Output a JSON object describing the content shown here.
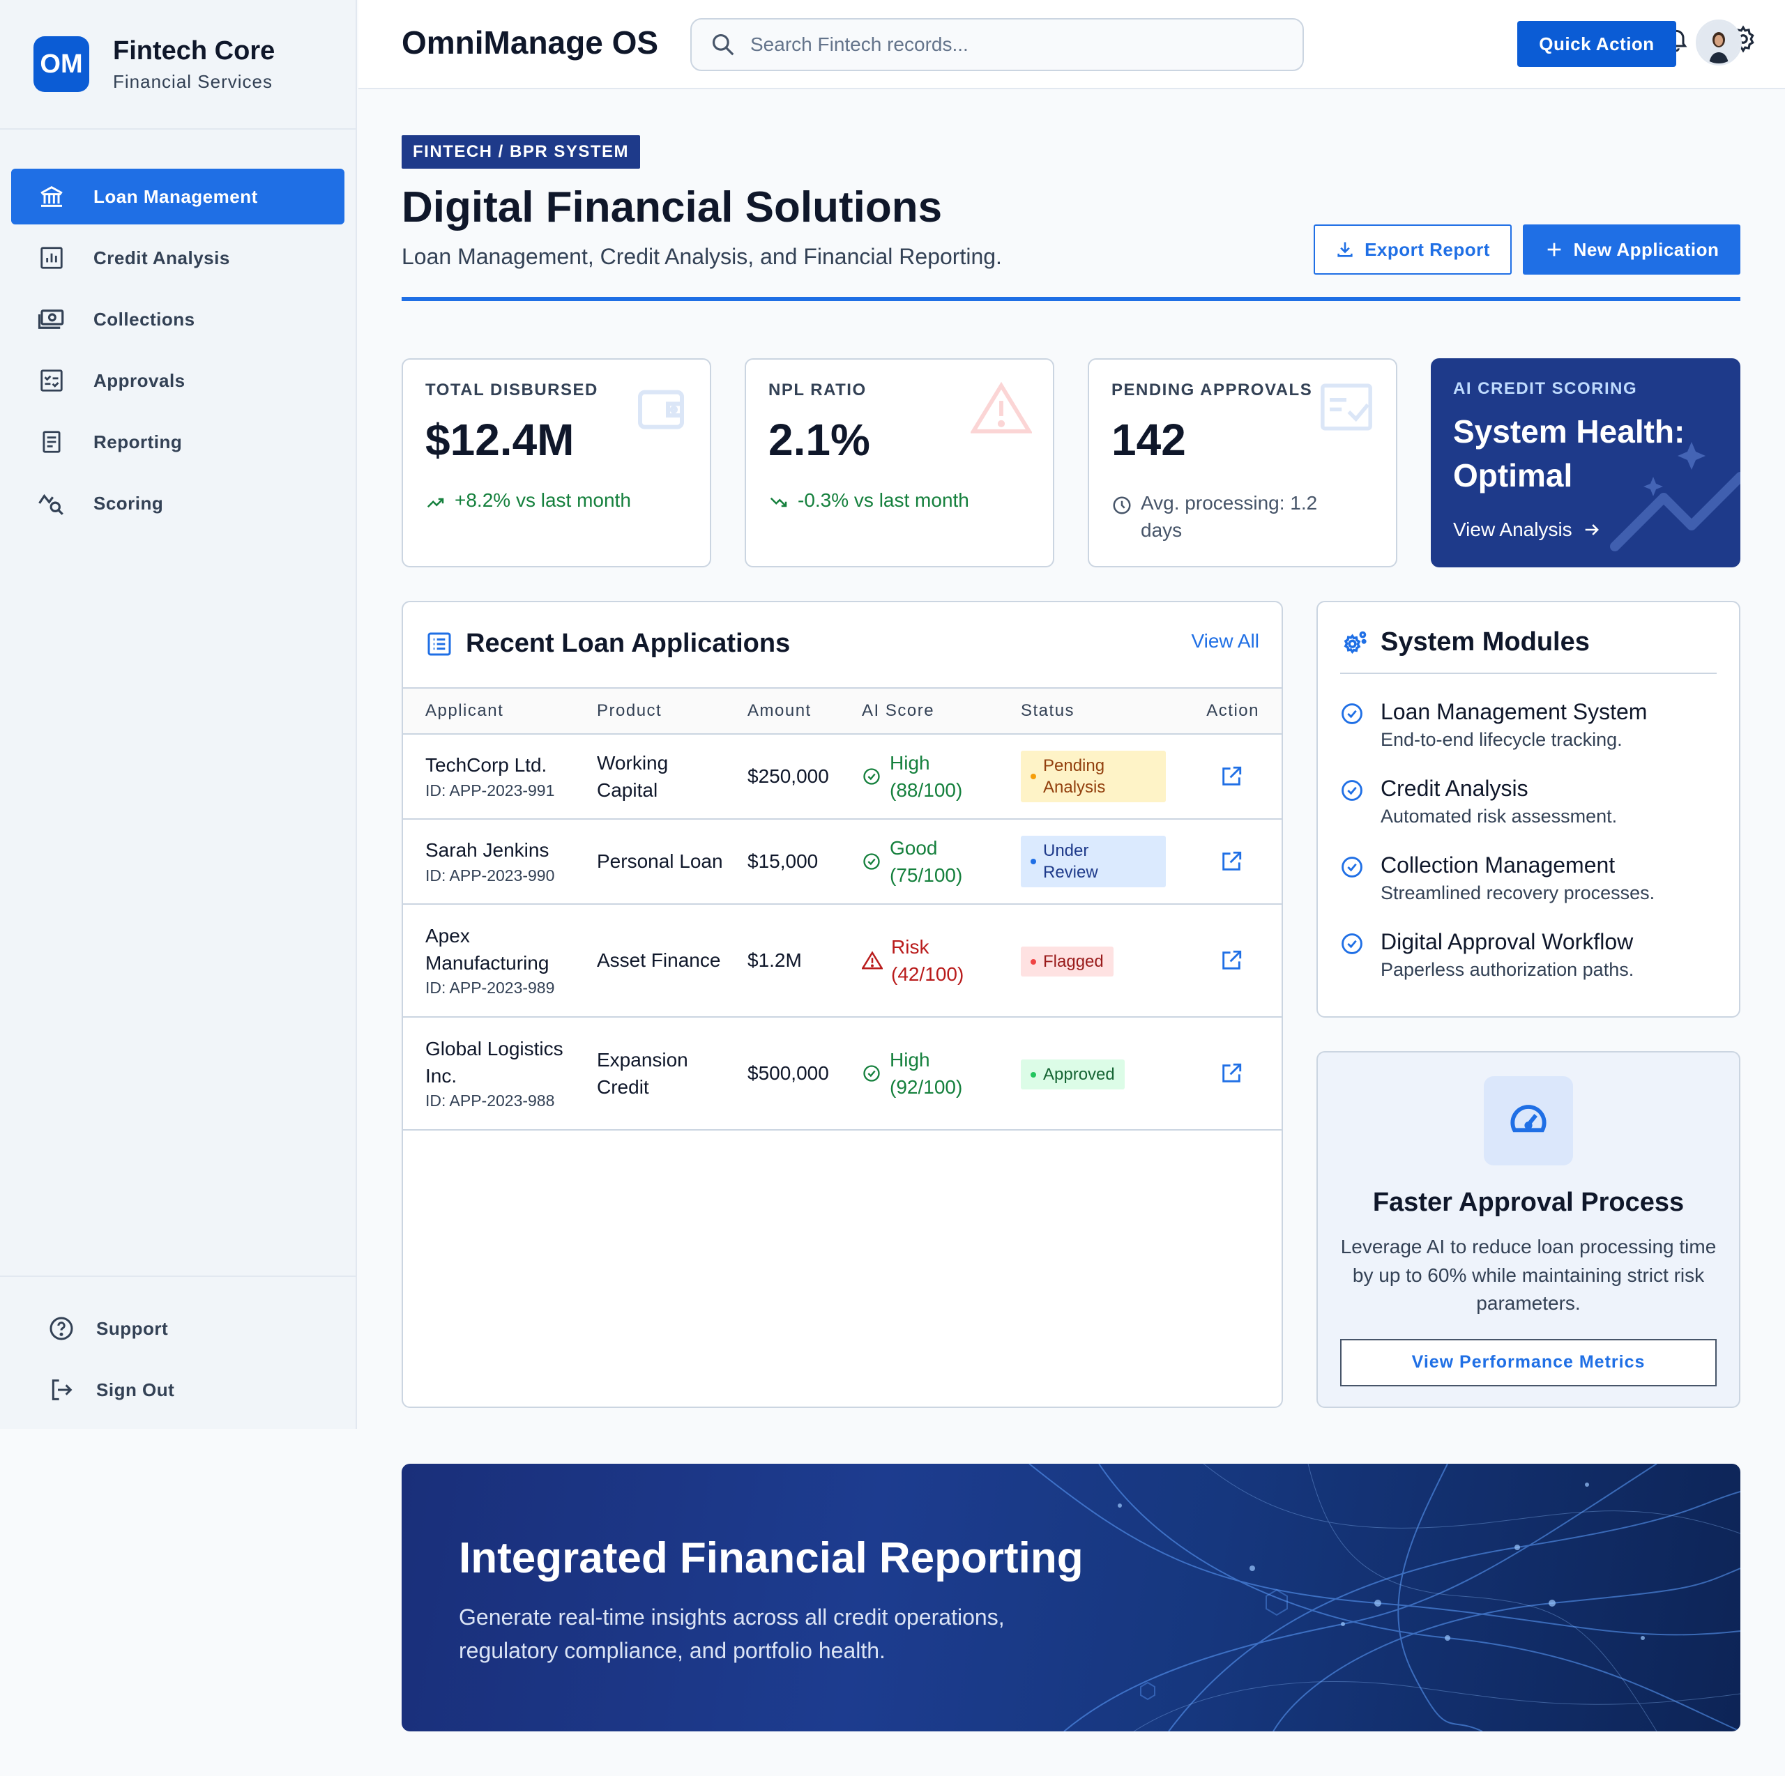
{
  "brand": {
    "logo": "OM",
    "title": "Fintech Core",
    "subtitle": "Financial Services"
  },
  "sidebar": {
    "items": [
      {
        "label": "Loan Management",
        "icon": "bank-icon",
        "active": true
      },
      {
        "label": "Credit Analysis",
        "icon": "chart-icon"
      },
      {
        "label": "Collections",
        "icon": "cash-icon"
      },
      {
        "label": "Approvals",
        "icon": "checklist-icon"
      },
      {
        "label": "Reporting",
        "icon": "document-icon"
      },
      {
        "label": "Scoring",
        "icon": "trend-search-icon"
      }
    ],
    "bottom": [
      {
        "label": "Support",
        "icon": "help-icon"
      },
      {
        "label": "Sign Out",
        "icon": "logout-icon"
      }
    ]
  },
  "header": {
    "title": "OmniManage OS",
    "search_placeholder": "Search Fintech records...",
    "quick_action": "Quick Action"
  },
  "page": {
    "tag": "FINTECH / BPR SYSTEM",
    "title": "Digital Financial Solutions",
    "subtitle": "Loan Management, Credit Analysis, and Financial Reporting.",
    "export_label": "Export Report",
    "new_label": "New Application"
  },
  "stats": [
    {
      "label": "TOTAL DISBURSED",
      "value": "$12.4M",
      "foot": "+8.2% vs last month"
    },
    {
      "label": "NPL RATIO",
      "value": "2.1%",
      "foot": "-0.3% vs last month"
    },
    {
      "label": "PENDING APPROVALS",
      "value": "142",
      "foot": "Avg. processing: 1.2 days"
    }
  ],
  "ai_card": {
    "label": "AI CREDIT SCORING",
    "title": "System Health: Optimal",
    "link": "View Analysis"
  },
  "loans": {
    "title": "Recent Loan Applications",
    "view_all": "View All",
    "columns": [
      "Applicant",
      "Product",
      "Amount",
      "AI Score",
      "Status",
      "Action"
    ],
    "rows": [
      {
        "name": "TechCorp Ltd.",
        "id": "ID: APP-2023-991",
        "product": "Working Capital",
        "amount": "$250,000",
        "score": "High (88/100)",
        "status": "Pending Analysis"
      },
      {
        "name": "Sarah Jenkins",
        "id": "ID: APP-2023-990",
        "product": "Personal Loan",
        "amount": "$15,000",
        "score": "Good (75/100)",
        "status": "Under Review"
      },
      {
        "name": "Apex Manufacturing",
        "id": "ID: APP-2023-989",
        "product": "Asset Finance",
        "amount": "$1.2M",
        "score": "Risk (42/100)",
        "status": "Flagged"
      },
      {
        "name": "Global Logistics Inc.",
        "id": "ID: APP-2023-988",
        "product": "Expansion Credit",
        "amount": "$500,000",
        "score": "High (92/100)",
        "status": "Approved"
      }
    ]
  },
  "modules": {
    "title": "System Modules",
    "items": [
      {
        "name": "Loan Management System",
        "desc": "End-to-end lifecycle tracking."
      },
      {
        "name": "Credit Analysis",
        "desc": "Automated risk assessment."
      },
      {
        "name": "Collection Management",
        "desc": "Streamlined recovery processes."
      },
      {
        "name": "Digital Approval Workflow",
        "desc": "Paperless authorization paths."
      }
    ]
  },
  "faster": {
    "title": "Faster Approval Process",
    "text": "Leverage AI to reduce loan processing time by up to 60% while maintaining strict risk parameters.",
    "button": "View Performance Metrics"
  },
  "banner": {
    "title": "Integrated Financial Reporting",
    "text": "Generate real-time insights across all credit operations, regulatory compliance, and portfolio health."
  },
  "colors": {
    "primary": "#1f6fe5",
    "navy": "#1e3a8a",
    "success": "#15803d",
    "danger": "#b91c1c"
  }
}
